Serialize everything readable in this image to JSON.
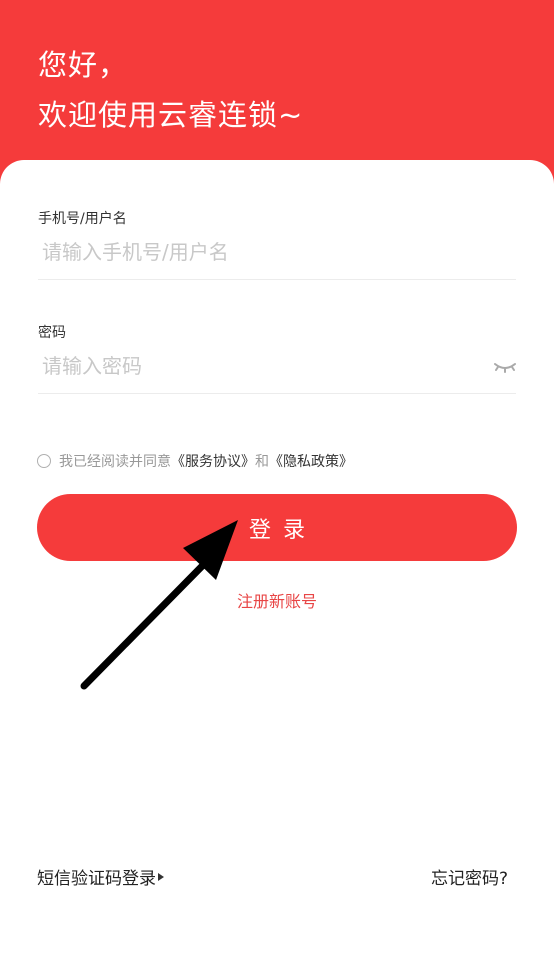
{
  "header": {
    "greeting_line1": "您好，",
    "greeting_line2": "欢迎使用云睿连锁~"
  },
  "form": {
    "account": {
      "label": "手机号/用户名",
      "placeholder": "请输入手机号/用户名",
      "value": ""
    },
    "password": {
      "label": "密码",
      "placeholder": "请输入密码",
      "value": "",
      "toggle_icon": "eye-closed-icon"
    },
    "agreement": {
      "checked": false,
      "prefix": "我已经阅读并同意",
      "service_link": "《服务协议》",
      "conjunction": "和",
      "privacy_link": "《隐私政策》"
    },
    "login_label": "登录",
    "register_label": "注册新账号"
  },
  "footer": {
    "sms_login_label": "短信验证码登录",
    "forgot_password_label": "忘记密码?"
  },
  "colors": {
    "brand_red": "#f53b3b",
    "link_red": "#e84545",
    "placeholder_gray": "#c8c8c8"
  }
}
